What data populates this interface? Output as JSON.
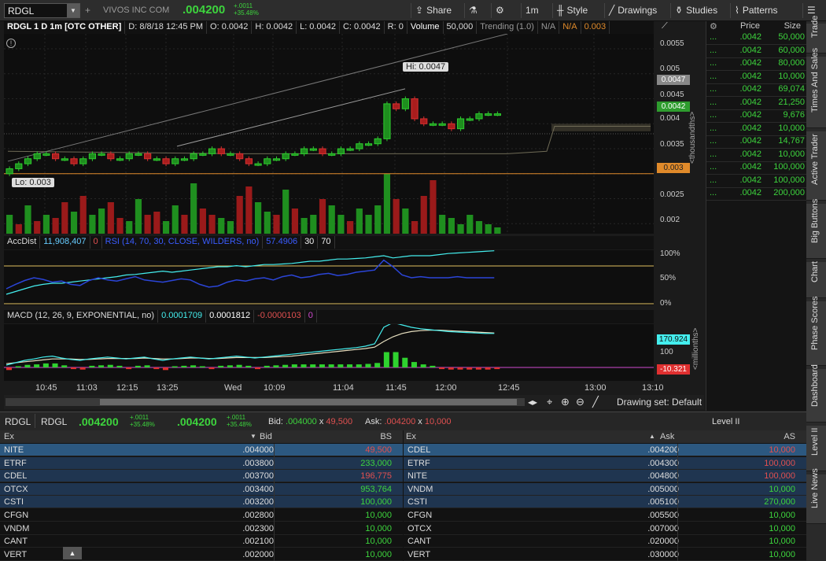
{
  "toolbar": {
    "symbol": "RDGL",
    "company": "VIVOS INC COM",
    "last": ".004200",
    "change": "+.0011",
    "change_pct": "+35.48%",
    "buttons": [
      "Share",
      "1m",
      "Style",
      "Drawings",
      "Studies",
      "Patterns"
    ]
  },
  "chart": {
    "header": [
      "RDGL 1 D 1m [OTC OTHER]",
      "D: 8/8/18 12:45 PM",
      "O: 0.0042",
      "H: 0.0042",
      "L: 0.0042",
      "C: 0.0042",
      "R: 0",
      "Volume",
      "50,000",
      "Trending (1.0)",
      "N/A",
      "N/A",
      "0.003"
    ],
    "hi_label": "Hi: 0.0047",
    "lo_label": "Lo: 0.003",
    "price_ticks": [
      "0.0055",
      "0.005",
      "0.0045",
      "0.004",
      "0.0035",
      "0.0025",
      "0.002"
    ],
    "price_badges": {
      "hi": "0.0047",
      "last": "0.0042",
      "mid": "0.0038",
      "lo": "0.003"
    },
    "axis_unit": "<thousandths>",
    "rsi_header": [
      "AccDist",
      "11,908,407",
      "0",
      "RSI (14, 70, 30, CLOSE, WILDERS, no)",
      "57.4906",
      "30",
      "70"
    ],
    "rsi_ticks": [
      "100%",
      "50%",
      "0%"
    ],
    "macd_header": [
      "MACD (12, 26, 9, EXPONENTIAL, no)",
      "0.0001709",
      "0.0001812",
      "-0.0000103",
      "0"
    ],
    "macd_ticks": [
      "100"
    ],
    "macd_badges": {
      "value": "170.924",
      "diff": "-10.321"
    },
    "macd_unit": "<millionths>",
    "time_ticks": [
      "10:45",
      "11:03",
      "12:15",
      "13:25",
      "Wed",
      "10:09",
      "11:04",
      "11:45",
      "12:00",
      "12:45",
      "13:00",
      "13:10"
    ],
    "drawing_set": "Drawing set: Default"
  },
  "chart_data": {
    "type": "candlestick",
    "title": "RDGL 1 D 1m [OTC OTHER]",
    "ylabel": "<thousandths>",
    "ylim": [
      0.0018,
      0.0058
    ],
    "hi": 0.0047,
    "lo": 0.003,
    "last": 0.0042,
    "closes": [
      0.0031,
      0.0032,
      0.0033,
      0.0034,
      0.0034,
      0.0033,
      0.0033,
      0.0032,
      0.0033,
      0.0034,
      0.0034,
      0.0033,
      0.0033,
      0.0034,
      0.0034,
      0.0033,
      0.0033,
      0.0032,
      0.0033,
      0.0033,
      0.0034,
      0.0034,
      0.0035,
      0.0034,
      0.0034,
      0.0033,
      0.0032,
      0.0032,
      0.0033,
      0.0033,
      0.0034,
      0.0034,
      0.0035,
      0.0035,
      0.0034,
      0.0034,
      0.0035,
      0.0035,
      0.0036,
      0.0036,
      0.0037,
      0.0044,
      0.0043,
      0.0045,
      0.0041,
      0.004,
      0.004,
      0.004,
      0.0039,
      0.0041,
      0.0041,
      0.0042,
      0.0042,
      0.0042
    ],
    "volumes": [
      0.3,
      0.15,
      0.45,
      0.2,
      0.3,
      0.25,
      0.5,
      0.35,
      0.6,
      0.3,
      0.4,
      0.5,
      0.25,
      0.2,
      0.55,
      0.3,
      0.35,
      0.2,
      0.45,
      0.3,
      0.8,
      0.4,
      0.3,
      0.25,
      0.2,
      0.6,
      0.75,
      0.5,
      0.35,
      0.3,
      0.7,
      0.4,
      0.25,
      0.3,
      0.55,
      0.45,
      0.3,
      0.2,
      0.4,
      0.3,
      0.45,
      0.95,
      0.55,
      0.4,
      0.2,
      0.6,
      0.85,
      0.3,
      0.25,
      0.15,
      0.3,
      0.2,
      0.15,
      0.1
    ],
    "vol_up": [
      1,
      0,
      1,
      0,
      1,
      0,
      0,
      1,
      0,
      1,
      1,
      0,
      0,
      1,
      1,
      0,
      0,
      1,
      1,
      0,
      1,
      0,
      0,
      1,
      1,
      0,
      0,
      1,
      1,
      0,
      1,
      0,
      1,
      1,
      0,
      1,
      1,
      0,
      1,
      1,
      1,
      1,
      0,
      1,
      0,
      0,
      0,
      1,
      1,
      1,
      1,
      1,
      1,
      1
    ],
    "rsi": [
      0.3,
      0.38,
      0.45,
      0.5,
      0.47,
      0.42,
      0.44,
      0.38,
      0.36,
      0.45,
      0.5,
      0.46,
      0.44,
      0.48,
      0.52,
      0.46,
      0.44,
      0.42,
      0.45,
      0.48,
      0.46,
      0.38,
      0.33,
      0.35,
      0.42,
      0.46,
      0.44,
      0.48,
      0.5,
      0.46,
      0.52,
      0.55,
      0.5,
      0.52,
      0.56,
      0.58,
      0.54,
      0.56,
      0.6,
      0.62,
      0.64,
      0.82,
      0.7,
      0.55,
      0.5,
      0.52,
      0.5,
      0.5,
      0.5,
      0.52,
      0.5,
      0.5,
      0.5,
      0.5
    ],
    "accdist": [
      0.2,
      0.25,
      0.3,
      0.35,
      0.38,
      0.4,
      0.4,
      0.42,
      0.44,
      0.46,
      0.48,
      0.5,
      0.52,
      0.55,
      0.56,
      0.58,
      0.6,
      0.62,
      0.6,
      0.62,
      0.64,
      0.66,
      0.68,
      0.7,
      0.7,
      0.72,
      0.7,
      0.72,
      0.74,
      0.74,
      0.75,
      0.76,
      0.78,
      0.8,
      0.8,
      0.82,
      0.84,
      0.84,
      0.85,
      0.86,
      0.88,
      0.9,
      0.86,
      0.88,
      0.9,
      0.9,
      0.9,
      0.92,
      0.94,
      0.95,
      0.96,
      0.97,
      0.98,
      0.99
    ],
    "macd": [
      0.05,
      0.1,
      0.15,
      0.18,
      0.22,
      0.24,
      0.2,
      0.17,
      0.15,
      0.18,
      0.2,
      0.22,
      0.2,
      0.18,
      0.2,
      0.22,
      0.18,
      0.15,
      0.18,
      0.2,
      0.22,
      0.2,
      0.18,
      0.2,
      0.22,
      0.24,
      0.22,
      0.2,
      0.22,
      0.24,
      0.26,
      0.28,
      0.3,
      0.32,
      0.34,
      0.36,
      0.38,
      0.4,
      0.42,
      0.45,
      0.5,
      0.85,
      0.95,
      0.9,
      0.85,
      0.82,
      0.8,
      0.78,
      0.76,
      0.75,
      0.74,
      0.73,
      0.72,
      0.72
    ],
    "signal": [
      0.08,
      0.1,
      0.12,
      0.14,
      0.16,
      0.18,
      0.18,
      0.18,
      0.17,
      0.17,
      0.18,
      0.19,
      0.19,
      0.19,
      0.19,
      0.2,
      0.19,
      0.18,
      0.18,
      0.19,
      0.2,
      0.2,
      0.19,
      0.19,
      0.2,
      0.21,
      0.21,
      0.21,
      0.21,
      0.22,
      0.23,
      0.24,
      0.26,
      0.28,
      0.3,
      0.32,
      0.34,
      0.36,
      0.38,
      0.4,
      0.43,
      0.55,
      0.65,
      0.72,
      0.76,
      0.78,
      0.79,
      0.79,
      0.78,
      0.77,
      0.76,
      0.75,
      0.74,
      0.73
    ]
  },
  "times_sales": {
    "headers": [
      "Price",
      "Size"
    ],
    "rows": [
      {
        "price": ".0042",
        "size": "50,000"
      },
      {
        "price": ".0042",
        "size": "60,000"
      },
      {
        "price": ".0042",
        "size": "80,000"
      },
      {
        "price": ".0042",
        "size": "10,000"
      },
      {
        "price": ".0042",
        "size": "69,074"
      },
      {
        "price": ".0042",
        "size": "21,250"
      },
      {
        "price": ".0042",
        "size": "9,676"
      },
      {
        "price": ".0042",
        "size": "10,000"
      },
      {
        "price": ".0042",
        "size": "14,767"
      },
      {
        "price": ".0042",
        "size": "10,000"
      },
      {
        "price": ".0042",
        "size": "100,000"
      },
      {
        "price": ".0042",
        "size": "100,000"
      },
      {
        "price": ".0042",
        "size": "200,000"
      }
    ]
  },
  "side_tabs": [
    "Trade",
    "Times And Sales",
    "Active Trader",
    "Big Buttons",
    "Chart",
    "Phase Scores",
    "Dashboard",
    "Level II",
    "Live News"
  ],
  "level2": {
    "symbol": "RDGL",
    "symbol2": "RDGL",
    "last": ".004200",
    "change": "+.0011",
    "change_pct": "+35.48%",
    "bid_label": "Bid:",
    "bid": ".004000",
    "bid_size": "49,500",
    "ask_label": "Ask:",
    "ask": ".004200",
    "ask_size": "10,000",
    "x": "x",
    "title": "Level II",
    "bid_headers": [
      "Ex",
      "Bid",
      "BS"
    ],
    "ask_headers": [
      "Ex",
      "Ask",
      "AS"
    ],
    "bids": [
      {
        "ex": "NITE",
        "price": ".004000",
        "size": "49,500",
        "c": "#e05050"
      },
      {
        "ex": "ETRF",
        "price": ".003800",
        "size": "233,000",
        "c": "#3dd43d"
      },
      {
        "ex": "CDEL",
        "price": ".003700",
        "size": "196,775",
        "c": "#e05050"
      },
      {
        "ex": "OTCX",
        "price": ".003400",
        "size": "953,764",
        "c": "#3dd43d"
      },
      {
        "ex": "CSTI",
        "price": ".003200",
        "size": "100,000",
        "c": "#3dd43d"
      },
      {
        "ex": "CFGN",
        "price": ".002800",
        "size": "10,000",
        "c": "#3dd43d"
      },
      {
        "ex": "VNDM",
        "price": ".002300",
        "size": "10,000",
        "c": "#3dd43d"
      },
      {
        "ex": "CANT",
        "price": ".002100",
        "size": "10,000",
        "c": "#3dd43d"
      },
      {
        "ex": "VERT",
        "price": ".002000",
        "size": "10,000",
        "c": "#3dd43d"
      }
    ],
    "asks": [
      {
        "ex": "CDEL",
        "price": ".004200",
        "size": "10,000",
        "c": "#e05050"
      },
      {
        "ex": "ETRF",
        "price": ".004300",
        "size": "100,000",
        "c": "#e05050"
      },
      {
        "ex": "NITE",
        "price": ".004800",
        "size": "100,000",
        "c": "#e05050"
      },
      {
        "ex": "VNDM",
        "price": ".005000",
        "size": "10,000",
        "c": "#3dd43d"
      },
      {
        "ex": "CSTI",
        "price": ".005100",
        "size": "270,000",
        "c": "#3dd43d"
      },
      {
        "ex": "CFGN",
        "price": ".005500",
        "size": "10,000",
        "c": "#3dd43d"
      },
      {
        "ex": "OTCX",
        "price": ".007000",
        "size": "10,000",
        "c": "#3dd43d"
      },
      {
        "ex": "CANT",
        "price": ".020000",
        "size": "10,000",
        "c": "#3dd43d"
      },
      {
        "ex": "VERT",
        "price": ".030000",
        "size": "10,000",
        "c": "#3dd43d"
      }
    ]
  }
}
